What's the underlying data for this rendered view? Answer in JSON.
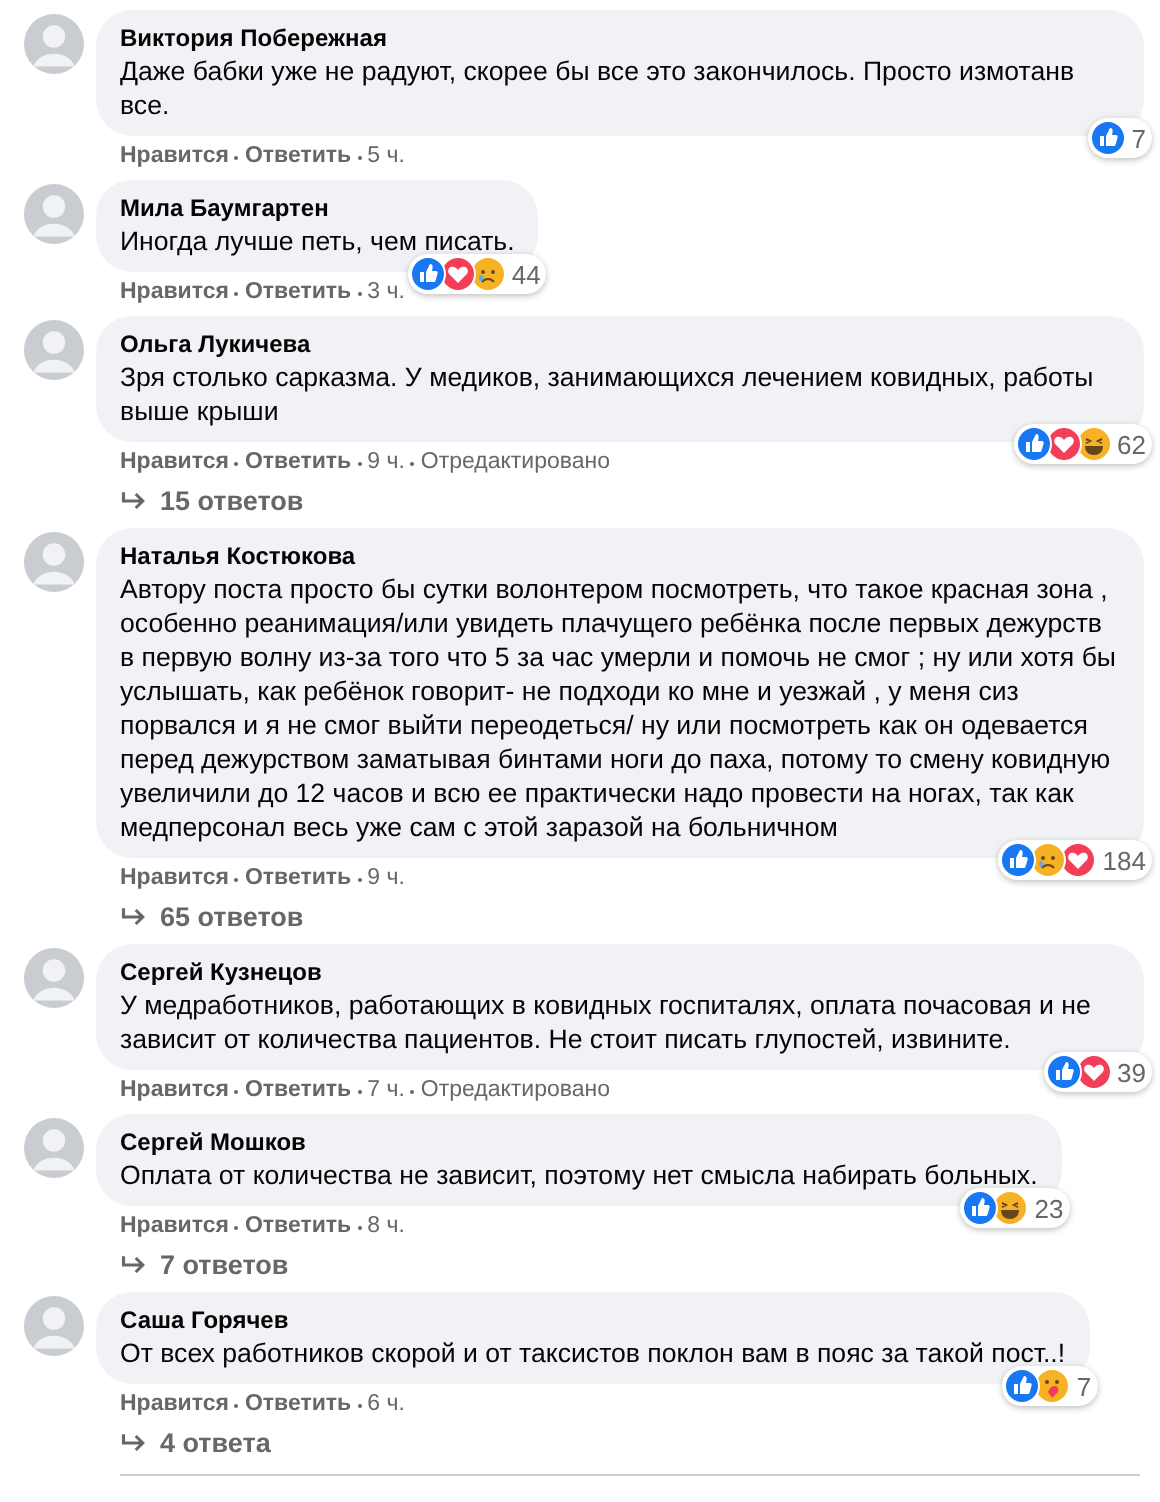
{
  "comments": [
    {
      "author": "Виктория Побережная",
      "text": "Даже бабки уже не радуют, скорее бы все это закончилось. Просто измотанв все.",
      "reactions": [
        {
          "kind": "like"
        }
      ],
      "reaction_count": "7",
      "actions": [
        "Нравится",
        "Ответить"
      ],
      "time": "5 ч."
    },
    {
      "author": "Мила Баумгартен",
      "text": "Иногда лучше петь, чем писать.",
      "reactions": [
        {
          "kind": "like"
        },
        {
          "kind": "love"
        },
        {
          "kind": "sad"
        }
      ],
      "reaction_count": "44",
      "actions": [
        "Нравится",
        "Ответить"
      ],
      "time": "3 ч."
    },
    {
      "author": "Ольга Лукичева",
      "text": "Зря столько сарказма. У медиков, занимающихся лечением ковидных, работы выше крыши",
      "reactions": [
        {
          "kind": "like"
        },
        {
          "kind": "love"
        },
        {
          "kind": "haha"
        }
      ],
      "reaction_count": "62",
      "actions": [
        "Нравится",
        "Ответить"
      ],
      "time": "9 ч.",
      "edited": "Отредактировано",
      "replies": "15 ответов"
    },
    {
      "author": "Наталья Костюкова",
      "text": "Автору поста просто бы сутки волонтером посмотреть, что такое красная зона , особенно реанимация/или увидеть плачущего ребёнка после первых дежурств в первую волну из-за того что 5 за час умерли и помочь не смог ; ну или хотя бы услышать, как ребёнок говорит- не подходи ко мне и уезжай , у меня сиз порвался и я не смог выйти переодеться/ ну или посмотреть как он одевается перед дежурством заматывая бинтами ноги до паха, потому то смену ковидную увеличили до 12 часов и всю ее практически надо провести на ногах, так как медперсонал весь уже сам с этой заразой на больничном",
      "reactions": [
        {
          "kind": "like"
        },
        {
          "kind": "sad"
        },
        {
          "kind": "love"
        }
      ],
      "reaction_count": "184",
      "actions": [
        "Нравится",
        "Ответить"
      ],
      "time": "9 ч.",
      "replies": "65 ответов"
    },
    {
      "author": "Сергей Кузнецов",
      "text": "У медработников, работающих в ковидных госпиталях, оплата почасовая и не зависит от количества пациентов. Не стоит писать глупостей, извините.",
      "reactions": [
        {
          "kind": "like"
        },
        {
          "kind": "love"
        }
      ],
      "reaction_count": "39",
      "actions": [
        "Нравится",
        "Ответить"
      ],
      "time": "7 ч.",
      "edited": "Отредактировано"
    },
    {
      "author": "Сергей Мошков",
      "text": "Оплата от количества не зависит, поэтому нет смысла набирать больных.",
      "reactions": [
        {
          "kind": "like"
        },
        {
          "kind": "haha"
        }
      ],
      "reaction_count": "23",
      "actions": [
        "Нравится",
        "Ответить"
      ],
      "time": "8 ч.",
      "replies": "7 ответов"
    },
    {
      "author": "Саша Горячев",
      "text": "От всех работников скорой и от таксистов поклон вам в пояс за такой пост..!",
      "reactions": [
        {
          "kind": "like"
        },
        {
          "kind": "care"
        }
      ],
      "reaction_count": "7",
      "actions": [
        "Нравится",
        "Ответить"
      ],
      "time": "6 ч.",
      "replies": "4 ответа"
    }
  ]
}
